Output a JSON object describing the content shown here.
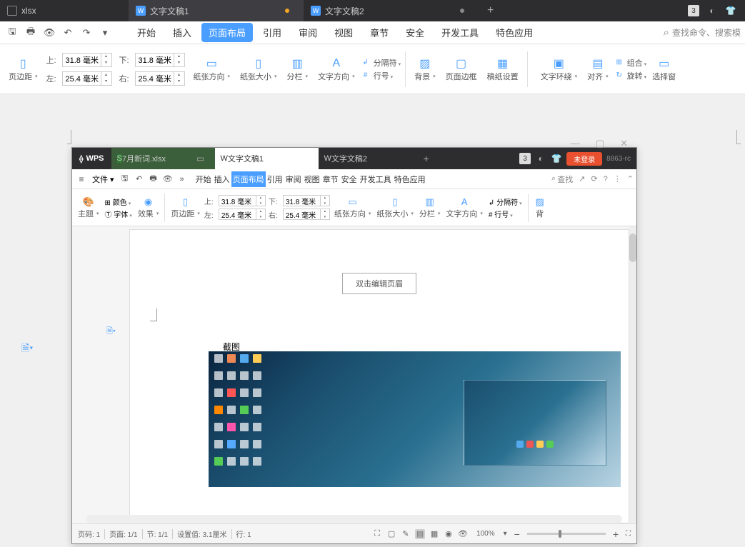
{
  "outer": {
    "tabs": [
      {
        "label": "xlsx",
        "type": "s"
      },
      {
        "label": "文字文稿1",
        "type": "w",
        "dot": "orange"
      },
      {
        "label": "文字文稿2",
        "type": "w",
        "dot": "grey"
      }
    ],
    "badge": "3",
    "menu": {
      "items": [
        "开始",
        "插入",
        "页面布局",
        "引用",
        "审阅",
        "视图",
        "章节",
        "安全",
        "开发工具",
        "特色应用"
      ],
      "active": 2,
      "search": "查找命令、搜索模"
    },
    "ribbon": {
      "margin_group_label": "页边距",
      "margins": {
        "top_label": "上:",
        "top": "31.8 毫米",
        "left_label": "左:",
        "left": "25.4 毫米",
        "bottom_label": "下:",
        "bottom": "31.8 毫米",
        "right_label": "右:",
        "right": "25.4 毫米"
      },
      "groups": {
        "paper_dir": "纸张方向",
        "paper_size": "纸张大小",
        "columns": "分栏",
        "text_dir": "文字方向",
        "section_break": "分隔符",
        "line_num": "行号",
        "background": "背景",
        "page_border": "页面边框",
        "manuscript": "稿纸设置",
        "text_wrap": "文字环绕",
        "align": "对齐",
        "group": "组合",
        "rotate": "旋转",
        "select_pane": "选择窗"
      }
    }
  },
  "inner": {
    "brand": "WPS",
    "tabs": [
      {
        "label": "7月新词.xlsx",
        "type": "s"
      },
      {
        "label": "文字文稿1",
        "type": "w",
        "dot": "orange"
      },
      {
        "label": "文字文稿2",
        "type": "w",
        "dot": "grey"
      }
    ],
    "badge": "3",
    "login": "未登录",
    "version": "8863-rc",
    "file_menu": "文件",
    "menu": {
      "items": [
        "开始",
        "插入",
        "页面布局",
        "引用",
        "审阅",
        "视图",
        "章节",
        "安全",
        "开发工具",
        "特色应用"
      ],
      "active": 2,
      "search": "查找"
    },
    "ribbon": {
      "theme": "主题",
      "color": "颜色",
      "font": "字体",
      "effect": "效果",
      "margin_label": "页边距",
      "margins": {
        "top_label": "上:",
        "top": "31.8 毫米",
        "left_label": "左:",
        "left": "25.4 毫米",
        "bottom_label": "下:",
        "bottom": "31.8 毫米",
        "right_label": "右:",
        "right": "25.4 毫米"
      },
      "paper_dir": "纸张方向",
      "paper_size": "纸张大小",
      "columns": "分栏",
      "text_dir": "文字方向",
      "section_break": "分隔符",
      "line_num": "行号",
      "bg": "背"
    },
    "doc": {
      "header_hint": "双击编辑页眉",
      "caption": "截图"
    },
    "status": {
      "page_num": "页码: 1",
      "page_of": "页面: 1/1",
      "section": "节: 1/1",
      "setting": "设置值: 3.1厘米",
      "line": "行: 1",
      "zoom": "100%"
    }
  }
}
